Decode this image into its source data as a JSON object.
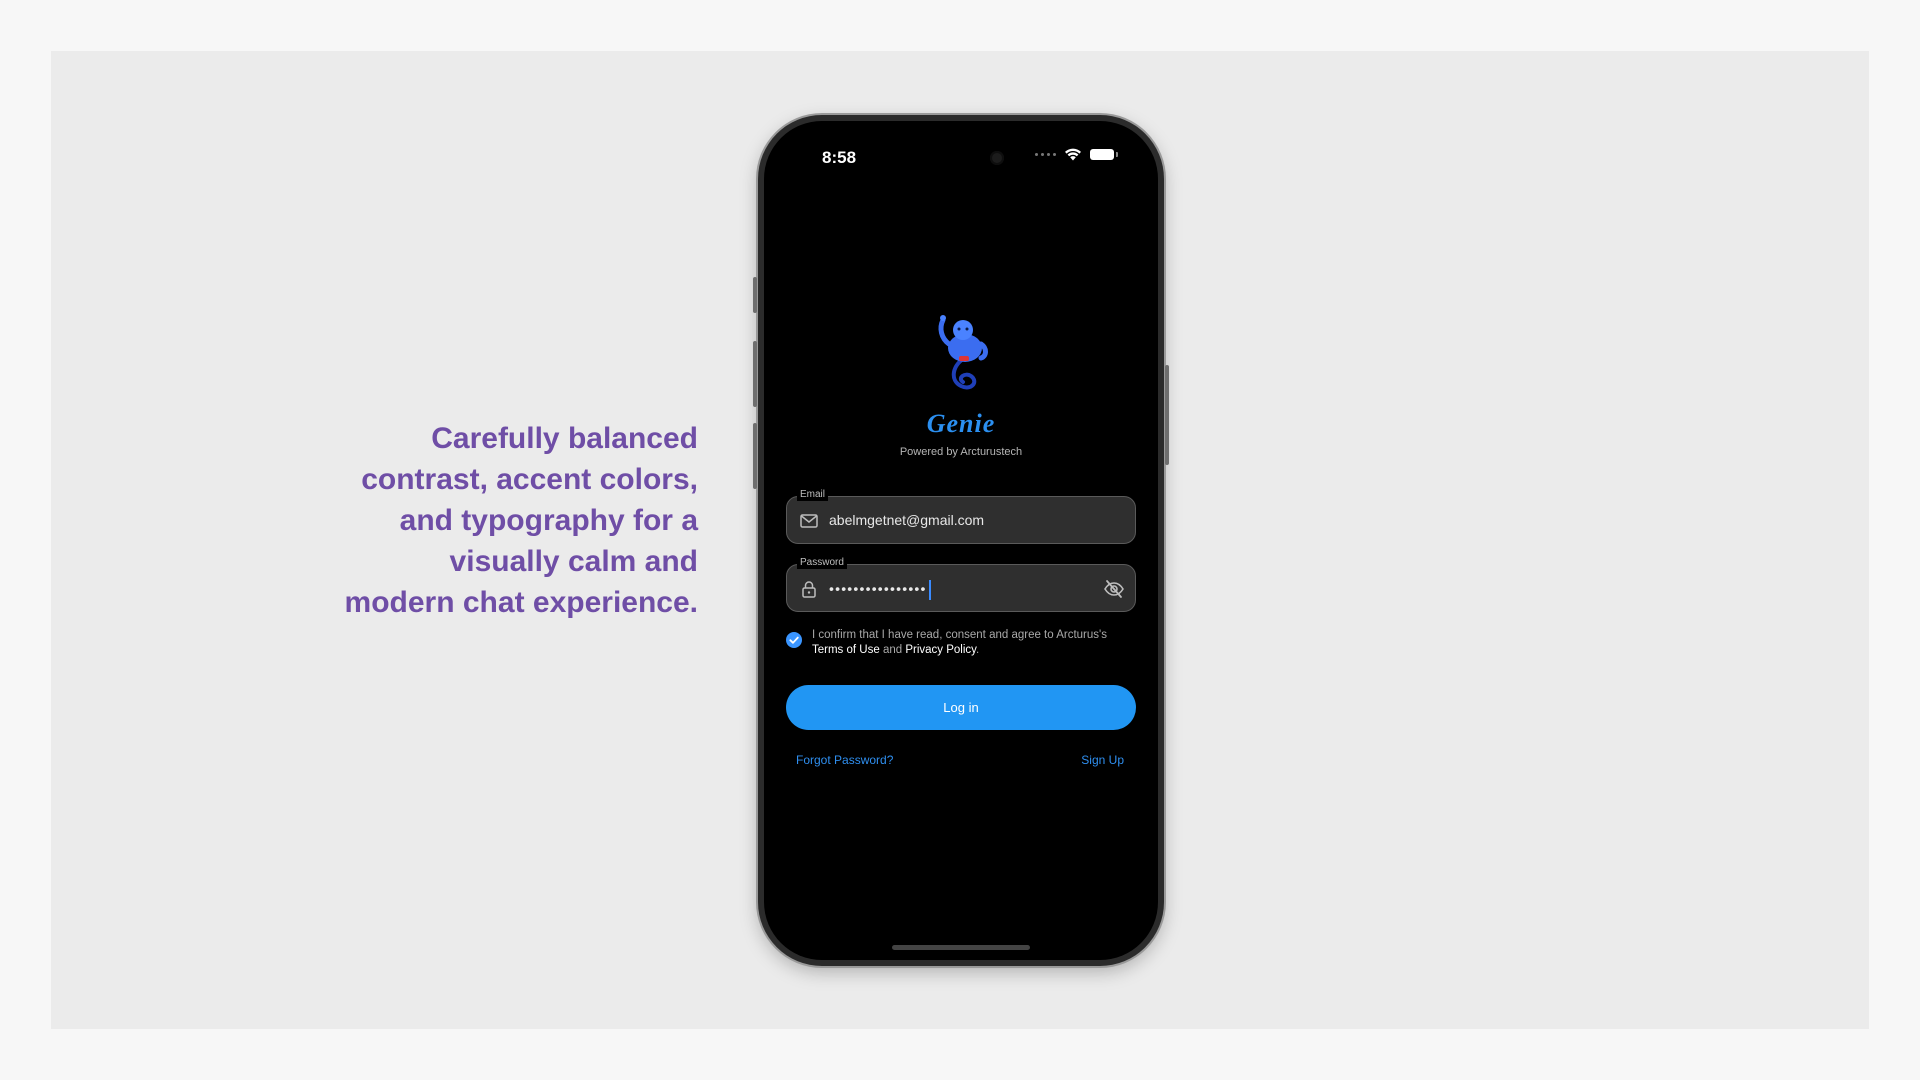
{
  "tagline": {
    "lines": [
      "Carefully balanced",
      "contrast, accent colors,",
      "and typography for a",
      "visually calm and",
      "modern chat experience."
    ]
  },
  "status_bar": {
    "time": "8:58"
  },
  "app": {
    "brand": "Genie",
    "powered_by": "Powered by Arcturustech"
  },
  "form": {
    "email": {
      "label": "Email",
      "value": "abelmgetnet@gmail.com",
      "icon": "mail-icon"
    },
    "password": {
      "label": "Password",
      "value": "••••••••••••••••",
      "icon": "lock-icon",
      "toggle_icon": "eye-off-icon"
    },
    "consent": {
      "checked": true,
      "prefix": "I confirm that I have read, consent and agree to Arcturus's ",
      "terms": "Terms of Use",
      "middle": " and ",
      "privacy": "Privacy Policy",
      "suffix": "."
    },
    "login_label": "Log in",
    "forgot_label": "Forgot Password?",
    "signup_label": "Sign Up"
  },
  "colors": {
    "accent": "#2196f3",
    "tagline": "#6f4ea6",
    "link": "#2f8ff0"
  }
}
